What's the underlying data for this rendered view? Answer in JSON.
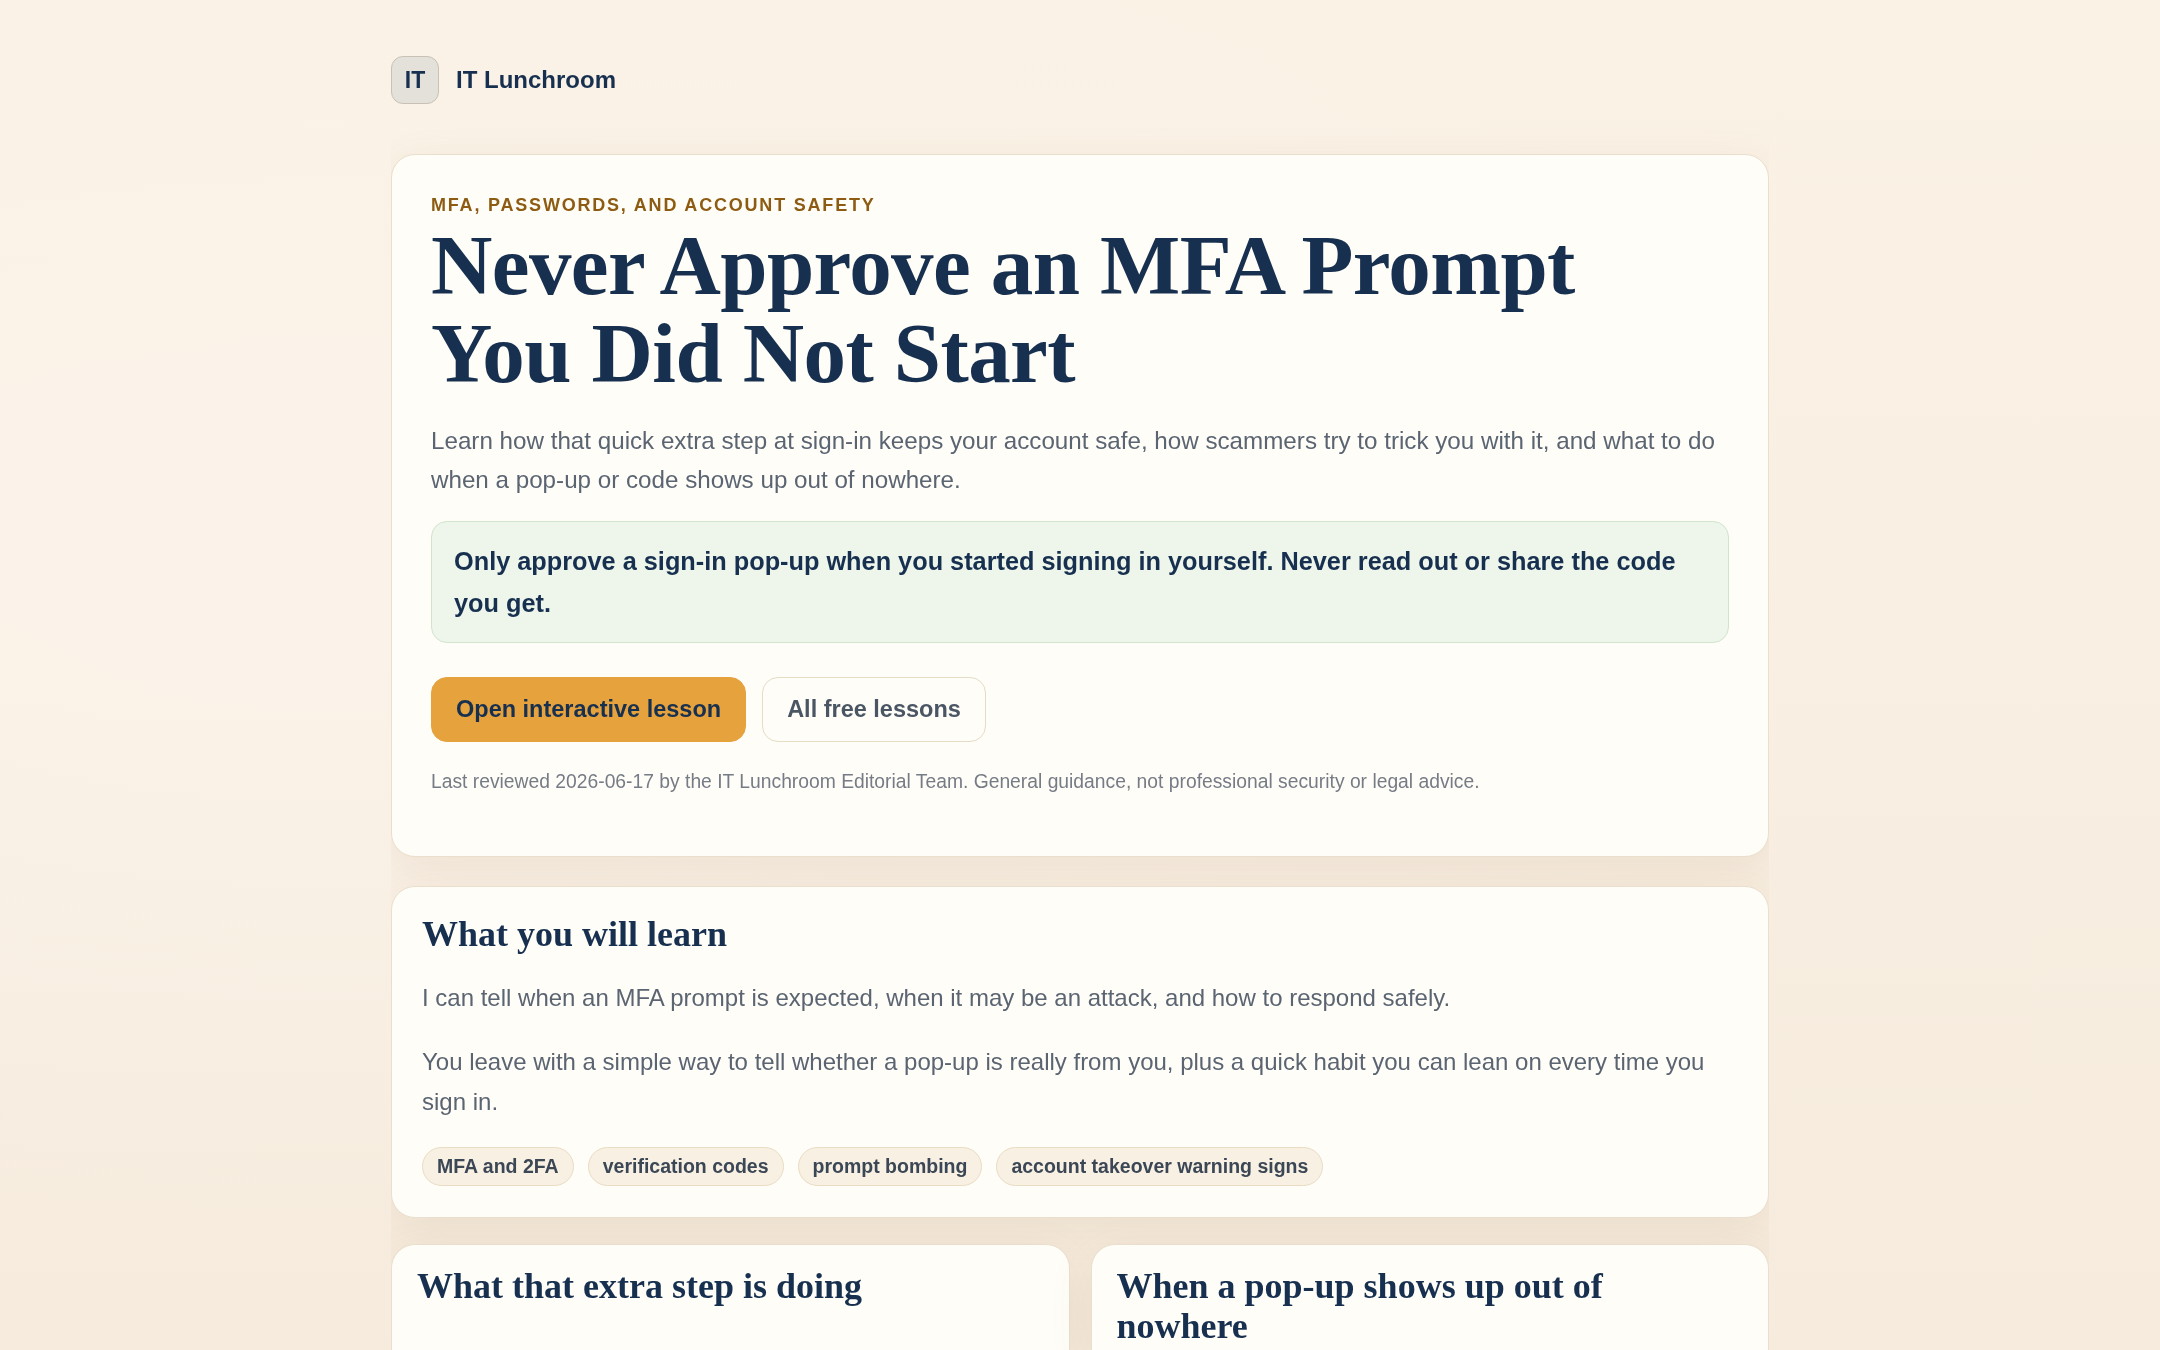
{
  "brand": {
    "logo": "IT",
    "name": "IT Lunchroom"
  },
  "hero": {
    "eyebrow": "MFA, PASSWORDS, AND ACCOUNT SAFETY",
    "title": "Never Approve an MFA Prompt You Did Not Start",
    "description": "Learn how that quick extra step at sign-in keeps your account safe, how scammers try to trick you with it, and what to do when a pop-up or code shows up out of nowhere.",
    "callout": "Only approve a sign-in pop-up when you started signing in yourself. Never read out or share the code you get.",
    "buttons": [
      {
        "label": "Open interactive lesson",
        "kind": "primary"
      },
      {
        "label": "All free lessons",
        "kind": "secondary"
      }
    ],
    "note": "Last reviewed 2026-06-17 by the IT Lunchroom Editorial Team. General guidance, not professional security or legal advice."
  },
  "learn": {
    "heading": "What you will learn",
    "paragraphs": [
      "I can tell when an MFA prompt is expected, when it may be an attack, and how to respond safely.",
      "You leave with a simple way to tell whether a pop-up is really from you, plus a quick habit you can lean on every time you sign in."
    ],
    "tags": [
      "MFA and 2FA",
      "verification codes",
      "prompt bombing",
      "account takeover warning signs"
    ]
  },
  "sections": [
    {
      "heading": "What that extra step is doing"
    },
    {
      "heading": "When a pop-up shows up out of nowhere"
    }
  ]
}
